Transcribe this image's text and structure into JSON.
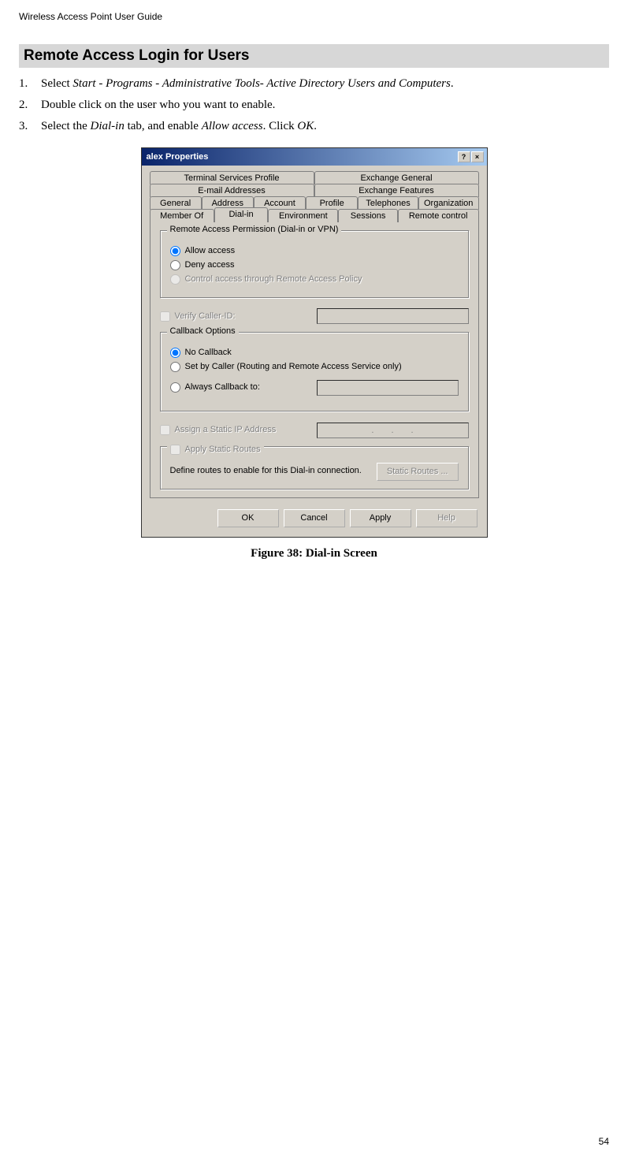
{
  "header": "Wireless Access Point User Guide",
  "section_title": "Remote Access Login for Users",
  "steps": [
    {
      "num": "1.",
      "prefix": "Select ",
      "italic": "Start - Programs - Administrative Tools- Active Directory Users and Computers",
      "suffix": "."
    },
    {
      "num": "2.",
      "prefix": "Double click on the user who you want to enable.",
      "italic": "",
      "suffix": ""
    },
    {
      "num": "3.",
      "prefix": "Select the ",
      "italic": "Dial-in",
      "mid": " tab, and enable ",
      "italic2": "Allow access",
      "mid2": ". Click ",
      "italic3": "OK",
      "suffix": "."
    }
  ],
  "dialog": {
    "title": "alex Properties",
    "tabs_row1": [
      "Terminal Services Profile",
      "Exchange General"
    ],
    "tabs_row2": [
      "E-mail Addresses",
      "Exchange Features"
    ],
    "tabs_row3": [
      "General",
      "Address",
      "Account",
      "Profile",
      "Telephones",
      "Organization"
    ],
    "tabs_row4": [
      "Member Of",
      "Dial-in",
      "Environment",
      "Sessions",
      "Remote control"
    ],
    "active_tab": "Dial-in",
    "group_permission": {
      "title": "Remote Access Permission (Dial-in or VPN)",
      "allow": "Allow access",
      "deny": "Deny access",
      "control": "Control access through Remote Access Policy"
    },
    "verify_caller": "Verify Caller-ID:",
    "group_callback": {
      "title": "Callback Options",
      "none": "No Callback",
      "setby": "Set by Caller (Routing and Remote Access Service only)",
      "always": "Always Callback to:"
    },
    "assign_ip": "Assign a Static IP Address",
    "apply_routes": "Apply Static Routes",
    "routes_desc": "Define routes to enable for this Dial-in connection.",
    "static_routes_btn": "Static Routes ...",
    "buttons": {
      "ok": "OK",
      "cancel": "Cancel",
      "apply": "Apply",
      "help": "Help"
    }
  },
  "figure_caption": "Figure 38: Dial-in Screen",
  "page_number": "54"
}
